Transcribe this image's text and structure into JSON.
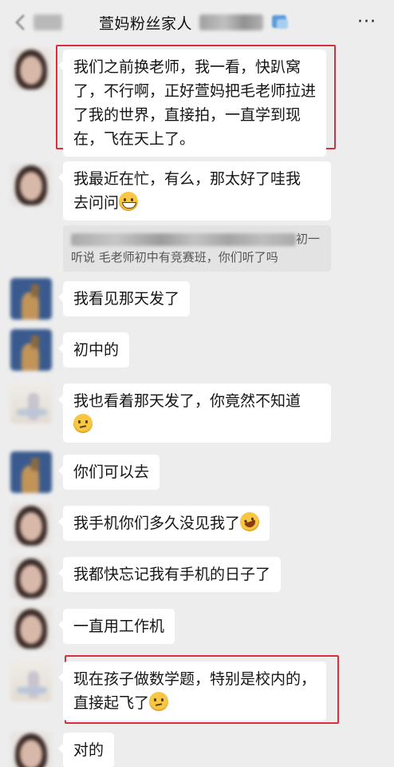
{
  "header": {
    "title": "萱妈粉丝家人",
    "more_label": "···"
  },
  "messages": [
    {
      "text": "我们之前换老师，我一看，快趴窝了，不行啊，正好萱妈把毛老师拉进了我的世界，直接拍，一直学到现在，飞在天上了。",
      "highlighted": true
    },
    {
      "text_lines": [
        "我最近在忙，有么，那太好了哇我",
        "去问问"
      ],
      "emoji": "grinning-emoji",
      "quote": {
        "text_tail": "初一",
        "line2": "听说 毛老师初中有竞赛班，你们听了吗"
      }
    },
    {
      "text": "我看见那天发了"
    },
    {
      "text": "初中的"
    },
    {
      "text_lines": [
        "我也看着那天发了，你竟然不知道"
      ],
      "emoji": "thinking-emoji"
    },
    {
      "text": "你们可以去"
    },
    {
      "text": "我手机你们多久没见我了",
      "emoji": "rolling-laughing-emoji"
    },
    {
      "text": "我都快忘记我有手机的日子了"
    },
    {
      "text": "一直用工作机"
    },
    {
      "text_lines": [
        "现在孩子做数学题，特别是校内的，",
        "直接起飞了"
      ],
      "emoji": "thinking-emoji",
      "highlighted": true
    },
    {
      "text": "对的"
    }
  ],
  "colors": {
    "background": "#ededed",
    "bubble": "#ffffff",
    "highlight_border": "#d7303d",
    "quote_bg": "#e3e3e3"
  }
}
